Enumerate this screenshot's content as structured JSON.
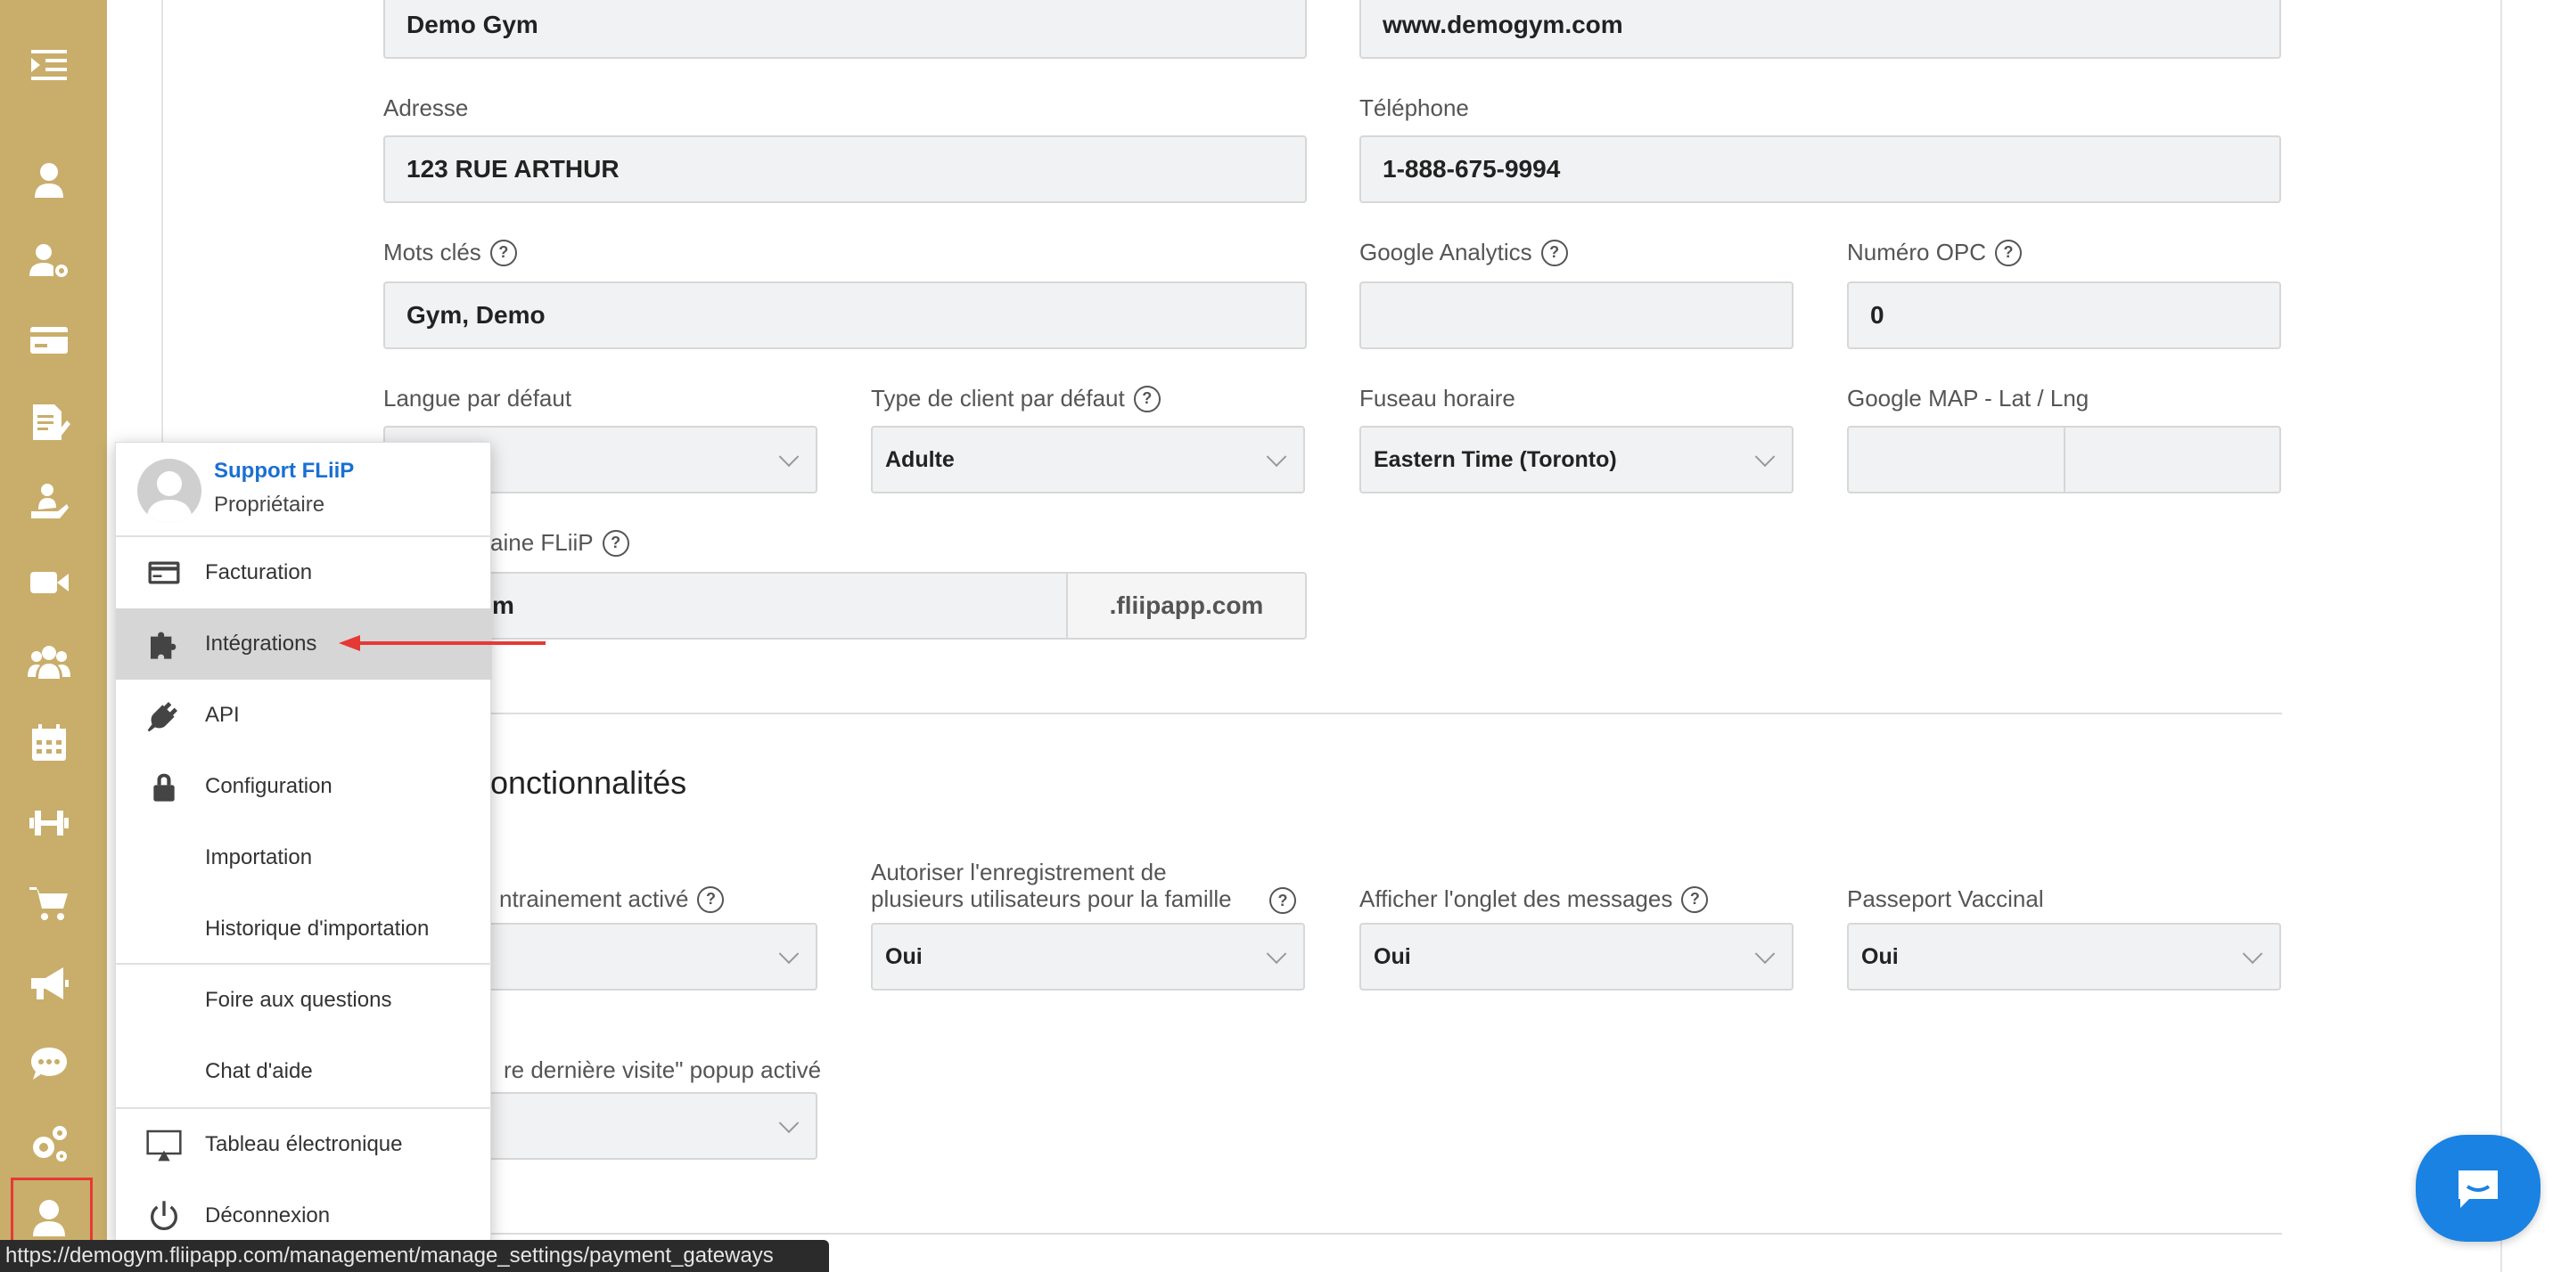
{
  "form": {
    "company_name_value": "Demo Gym",
    "website_value": "www.demogym.com",
    "address_label": "Adresse",
    "address_value": "123 RUE ARTHUR",
    "phone_label": "Téléphone",
    "phone_value": "1-888-675-9994",
    "keywords_label": "Mots clés",
    "keywords_value": "Gym, Demo",
    "analytics_label": "Google Analytics",
    "analytics_value": "",
    "opc_label": "Numéro OPC",
    "opc_value": "0",
    "language_label": "Langue par défaut",
    "client_type_label": "Type de client par défaut",
    "client_type_value": "Adulte",
    "timezone_label": "Fuseau horaire",
    "timezone_value": "Eastern Time (Toronto)",
    "map_label": "Google MAP - Lat / Lng",
    "domain_label_partial": "aine FLiiP",
    "domain_value_partial": "m",
    "domain_suffix": ".fliipapp.com"
  },
  "features": {
    "title_partial": "fonctionnalités",
    "training_label_partial": "ntrainement activé",
    "family_label_line1": "Autoriser l'enregistrement de",
    "family_label_line2": "plusieurs utilisateurs pour la famille",
    "family_value": "Oui",
    "messages_label": "Afficher l'onglet des messages",
    "messages_value": "Oui",
    "vaccine_label": "Passeport Vaccinal",
    "vaccine_value": "Oui",
    "last_visit_label_partial": "re dernière visite\" popup activé"
  },
  "user_menu": {
    "user_name": "Support FLiiP",
    "user_role": "Propriétaire",
    "items": [
      {
        "label": "Facturation",
        "icon": "credit-card-icon"
      },
      {
        "label": "Intégrations",
        "icon": "puzzle-icon"
      },
      {
        "label": "API",
        "icon": "plug-icon"
      },
      {
        "label": "Configuration",
        "icon": "lock-icon"
      },
      {
        "label": "Importation",
        "icon": ""
      },
      {
        "label": "Historique d'importation",
        "icon": ""
      },
      {
        "label": "Foire aux questions",
        "icon": ""
      },
      {
        "label": "Chat d'aide",
        "icon": ""
      },
      {
        "label": "Tableau électronique",
        "icon": "screen-icon"
      },
      {
        "label": "Déconnexion",
        "icon": "power-icon"
      }
    ]
  },
  "status_bar": {
    "url": "https://demogym.fliipapp.com/management/manage_settings/payment_gateways"
  },
  "colors": {
    "sidebar": "#c9ad6a",
    "accent_blue": "#1a82e2",
    "highlight_red": "#e53935"
  }
}
